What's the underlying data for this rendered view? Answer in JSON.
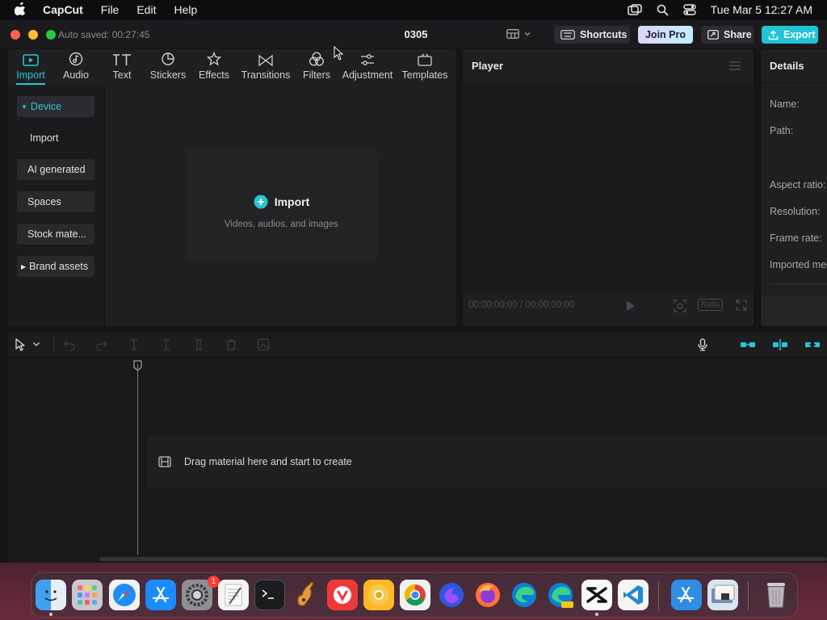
{
  "menubar": {
    "app_name": "CapCut",
    "items": [
      "File",
      "Edit",
      "Help"
    ],
    "clock": "Tue Mar 5  12:27 AM"
  },
  "titlebar": {
    "autosave": "Auto saved: 00:27:45",
    "project_name": "0305",
    "shortcuts_label": "Shortcuts",
    "join_pro_label": "Join Pro",
    "share_label": "Share",
    "export_label": "Export"
  },
  "toolbar": {
    "tabs": [
      "Import",
      "Audio",
      "Text",
      "Stickers",
      "Effects",
      "Transitions",
      "Filters",
      "Adjustment",
      "Templates"
    ],
    "active": "Import"
  },
  "sidebar": {
    "items": [
      "Device",
      "Import",
      "AI generated",
      "Spaces",
      "Stock mate...",
      "Brand assets"
    ]
  },
  "import_zone": {
    "label": "Import",
    "hint": "Videos, audios, and images"
  },
  "player": {
    "title": "Player",
    "timecode": "00:00:00:00 / 00:00:00:00",
    "ratio_label": "Ratio"
  },
  "details": {
    "title": "Details",
    "labels": [
      "Name:",
      "Path:",
      "Aspect ratio:",
      "Resolution:",
      "Frame rate:",
      "Imported media:"
    ]
  },
  "timeline": {
    "drop_hint": "Drag material here and start to create"
  },
  "dock": {
    "settings_badge": "1"
  },
  "colors": {
    "accent": "#28c5d8",
    "export": "#21c3d6",
    "panel": "#1f1f21",
    "window": "#141416",
    "badge": "#ff3b30"
  }
}
